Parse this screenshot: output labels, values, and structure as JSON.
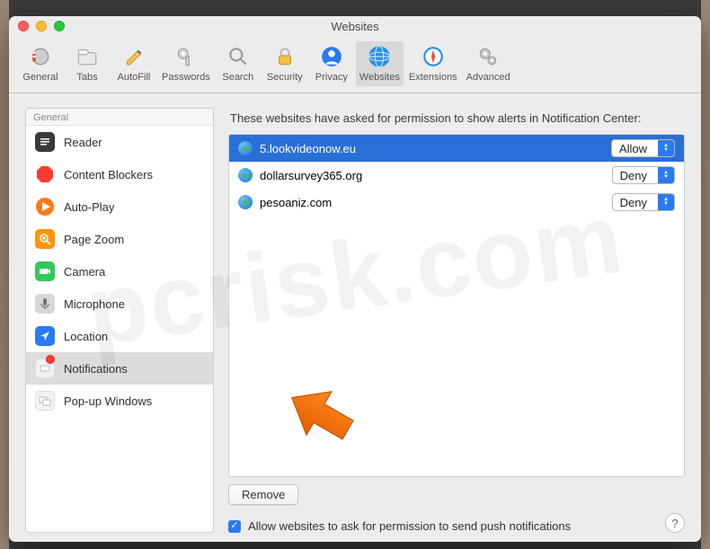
{
  "window_title": "Websites",
  "toolbar": [
    {
      "name": "general",
      "label": "General"
    },
    {
      "name": "tabs",
      "label": "Tabs"
    },
    {
      "name": "autofill",
      "label": "AutoFill"
    },
    {
      "name": "passwords",
      "label": "Passwords"
    },
    {
      "name": "search",
      "label": "Search"
    },
    {
      "name": "security",
      "label": "Security"
    },
    {
      "name": "privacy",
      "label": "Privacy"
    },
    {
      "name": "websites",
      "label": "Websites",
      "active": true
    },
    {
      "name": "extensions",
      "label": "Extensions"
    },
    {
      "name": "advanced",
      "label": "Advanced"
    }
  ],
  "sidebar": {
    "section": "General",
    "items": [
      {
        "name": "reader",
        "label": "Reader"
      },
      {
        "name": "content-blockers",
        "label": "Content Blockers"
      },
      {
        "name": "auto-play",
        "label": "Auto-Play"
      },
      {
        "name": "page-zoom",
        "label": "Page Zoom"
      },
      {
        "name": "camera",
        "label": "Camera"
      },
      {
        "name": "microphone",
        "label": "Microphone"
      },
      {
        "name": "location",
        "label": "Location"
      },
      {
        "name": "notifications",
        "label": "Notifications",
        "selected": true,
        "badge": true
      },
      {
        "name": "popup-windows",
        "label": "Pop-up Windows"
      }
    ]
  },
  "heading": "These websites have asked for permission to show alerts in Notification Center:",
  "sites": [
    {
      "domain": "5.lookvideonow.eu",
      "permission": "Allow",
      "selected": true
    },
    {
      "domain": "dollarsurvey365.org",
      "permission": "Deny"
    },
    {
      "domain": "pesoaniz.com",
      "permission": "Deny"
    }
  ],
  "remove_label": "Remove",
  "checkbox_label": "Allow websites to ask for permission to send push notifications",
  "checkbox_checked": true,
  "help_label": "?",
  "watermark": "pcrisk.com"
}
